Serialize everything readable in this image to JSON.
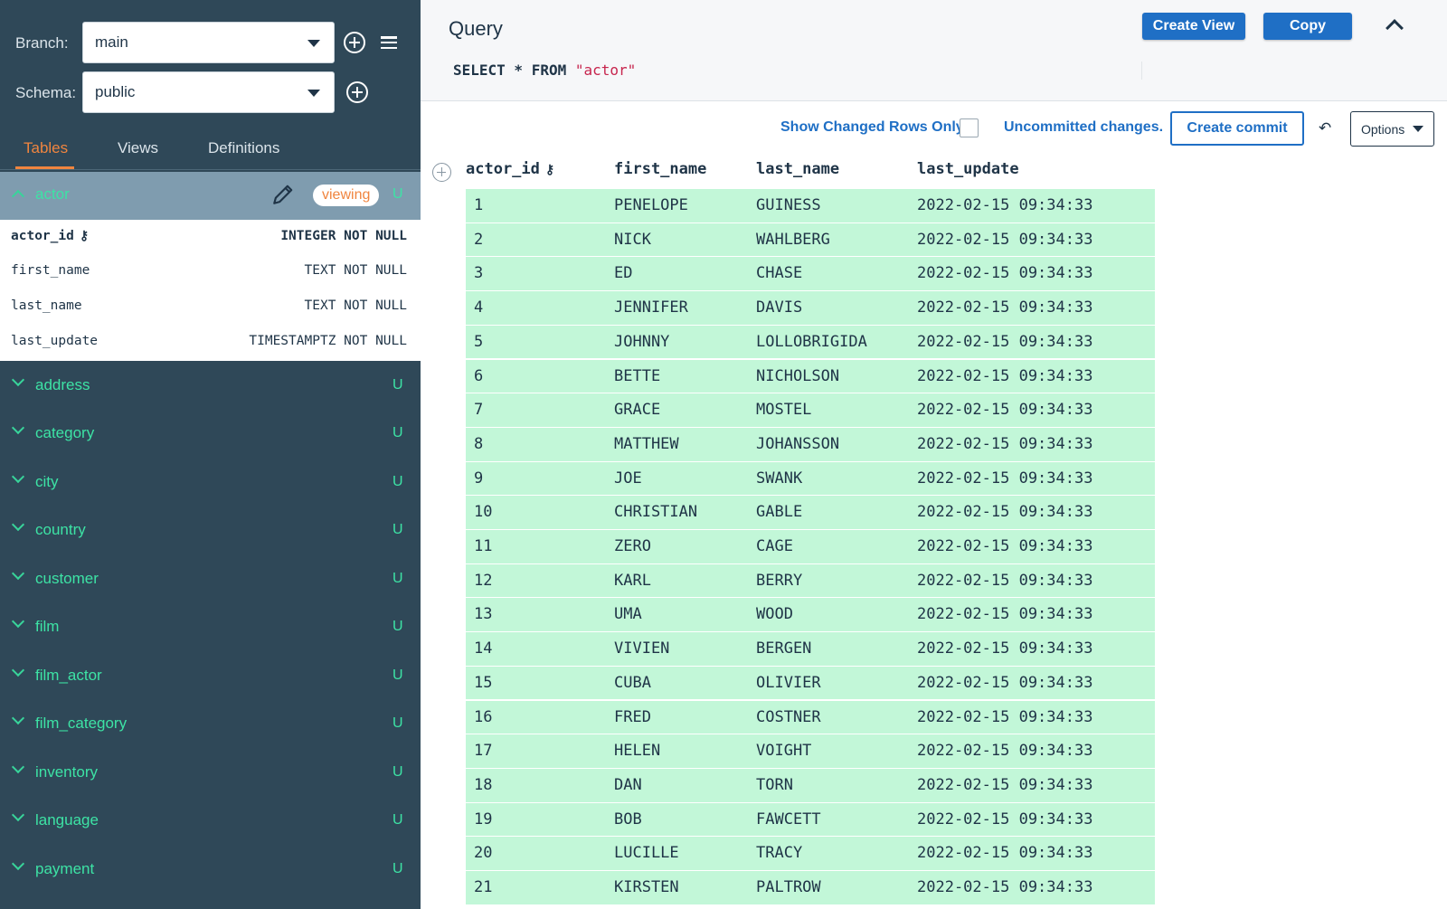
{
  "sidebar": {
    "branch_label": "Branch:",
    "branch_value": "main",
    "schema_label": "Schema:",
    "schema_value": "public",
    "tabs": [
      "Tables",
      "Views",
      "Definitions"
    ],
    "active_table": {
      "name": "actor",
      "badge": "viewing",
      "flag": "U",
      "columns": [
        {
          "name": "actor_id",
          "type": "INTEGER NOT NULL"
        },
        {
          "name": "first_name",
          "type": "TEXT NOT NULL"
        },
        {
          "name": "last_name",
          "type": "TEXT NOT NULL"
        },
        {
          "name": "last_update",
          "type": "TIMESTAMPTZ NOT NULL"
        }
      ]
    },
    "tables": [
      {
        "name": "address",
        "flag": "U"
      },
      {
        "name": "category",
        "flag": "U"
      },
      {
        "name": "city",
        "flag": "U"
      },
      {
        "name": "country",
        "flag": "U"
      },
      {
        "name": "customer",
        "flag": "U"
      },
      {
        "name": "film",
        "flag": "U"
      },
      {
        "name": "film_actor",
        "flag": "U"
      },
      {
        "name": "film_category",
        "flag": "U"
      },
      {
        "name": "inventory",
        "flag": "U"
      },
      {
        "name": "language",
        "flag": "U"
      },
      {
        "name": "payment",
        "flag": "U"
      }
    ]
  },
  "query": {
    "title": "Query",
    "sql_keyword": "SELECT * FROM",
    "sql_table": "\"actor\"",
    "create_view_label": "Create View",
    "copy_label": "Copy"
  },
  "toolbar": {
    "show_changed_label": "Show Changed Rows Only",
    "uncommitted_label": "Uncommitted changes.",
    "create_commit_label": "Create commit",
    "options_label": "Options"
  },
  "grid": {
    "columns": [
      "actor_id",
      "first_name",
      "last_name",
      "last_update"
    ],
    "rows": [
      [
        "1",
        "PENELOPE",
        "GUINESS",
        "2022-02-15 09:34:33"
      ],
      [
        "2",
        "NICK",
        "WAHLBERG",
        "2022-02-15 09:34:33"
      ],
      [
        "3",
        "ED",
        "CHASE",
        "2022-02-15 09:34:33"
      ],
      [
        "4",
        "JENNIFER",
        "DAVIS",
        "2022-02-15 09:34:33"
      ],
      [
        "5",
        "JOHNNY",
        "LOLLOBRIGIDA",
        "2022-02-15 09:34:33"
      ],
      [
        "6",
        "BETTE",
        "NICHOLSON",
        "2022-02-15 09:34:33"
      ],
      [
        "7",
        "GRACE",
        "MOSTEL",
        "2022-02-15 09:34:33"
      ],
      [
        "8",
        "MATTHEW",
        "JOHANSSON",
        "2022-02-15 09:34:33"
      ],
      [
        "9",
        "JOE",
        "SWANK",
        "2022-02-15 09:34:33"
      ],
      [
        "10",
        "CHRISTIAN",
        "GABLE",
        "2022-02-15 09:34:33"
      ],
      [
        "11",
        "ZERO",
        "CAGE",
        "2022-02-15 09:34:33"
      ],
      [
        "12",
        "KARL",
        "BERRY",
        "2022-02-15 09:34:33"
      ],
      [
        "13",
        "UMA",
        "WOOD",
        "2022-02-15 09:34:33"
      ],
      [
        "14",
        "VIVIEN",
        "BERGEN",
        "2022-02-15 09:34:33"
      ],
      [
        "15",
        "CUBA",
        "OLIVIER",
        "2022-02-15 09:34:33"
      ],
      [
        "16",
        "FRED",
        "COSTNER",
        "2022-02-15 09:34:33"
      ],
      [
        "17",
        "HELEN",
        "VOIGHT",
        "2022-02-15 09:34:33"
      ],
      [
        "18",
        "DAN",
        "TORN",
        "2022-02-15 09:34:33"
      ],
      [
        "19",
        "BOB",
        "FAWCETT",
        "2022-02-15 09:34:33"
      ],
      [
        "20",
        "LUCILLE",
        "TRACY",
        "2022-02-15 09:34:33"
      ],
      [
        "21",
        "KIRSTEN",
        "PALTROW",
        "2022-02-15 09:34:33"
      ]
    ]
  },
  "colors": {
    "sidebar_bg": "#2f4858",
    "accent_orange": "#f0853f",
    "accent_green": "#3de3a5",
    "primary_blue": "#1f6fc5",
    "changed_row_bg": "#c2f7d8"
  }
}
